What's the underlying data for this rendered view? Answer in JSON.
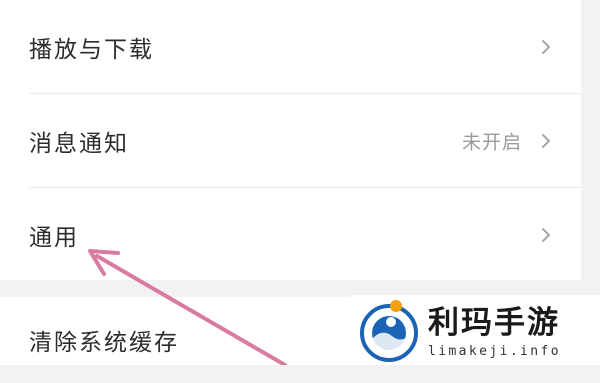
{
  "settings": {
    "rows": [
      {
        "label": "播放与下载",
        "value": ""
      },
      {
        "label": "消息通知",
        "value": "未开启"
      },
      {
        "label": "通用",
        "value": ""
      },
      {
        "label": "清除系统缓存",
        "value": ""
      }
    ]
  },
  "watermark": {
    "title": "利玛手游",
    "url": "limakeji.info"
  },
  "colors": {
    "page_background": "#f2f2f2",
    "row_background": "#ffffff",
    "label_text": "#2c2c2c",
    "secondary_text": "#9a9a9a",
    "annotation_arrow": "#d97aa0",
    "logo_blue": "#1b63b5",
    "logo_orange": "#f2a012"
  },
  "icons": {
    "row_chevron": "chevron-right-icon",
    "annotation": "arrow-annotation-icon",
    "watermark_logo": "watermark-logo-icon"
  }
}
